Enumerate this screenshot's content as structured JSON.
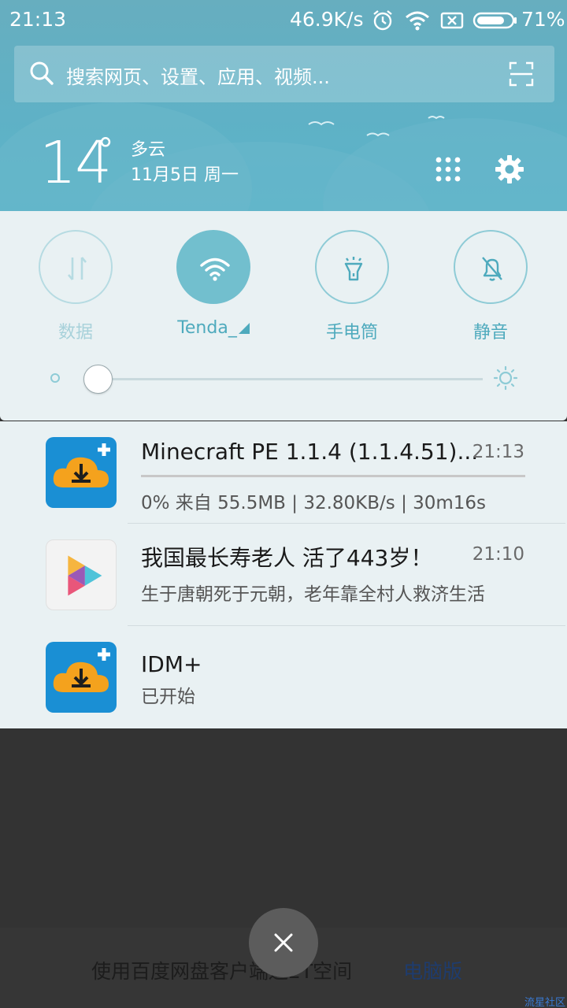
{
  "status_bar": {
    "time": "21:13",
    "net_speed": "46.9K/s",
    "battery_percent": "71%",
    "icons": [
      "alarm-icon",
      "wifi-icon",
      "sim-off-icon",
      "battery-icon"
    ]
  },
  "search": {
    "placeholder": "搜索网页、设置、应用、视频..."
  },
  "weather": {
    "temperature": "14",
    "degree": "°",
    "condition": "多云",
    "date": "11月5日 周一"
  },
  "toggles": [
    {
      "label": "数据",
      "icon": "data-transfer-icon",
      "state": "off"
    },
    {
      "label": "Tenda_",
      "icon": "wifi-icon",
      "state": "on"
    },
    {
      "label": "手电筒",
      "icon": "flashlight-icon",
      "state": "off"
    },
    {
      "label": "静音",
      "icon": "mute-bell-icon",
      "state": "off"
    }
  ],
  "brightness": {
    "level": 0.03
  },
  "notifications": [
    {
      "title": "Minecraft PE 1.1.4 (1.1.4.51)...",
      "time": "21:13",
      "subtitle": "0% 来自 55.5MB | 32.80KB/s | 30m16s",
      "progress": 0,
      "app_icon": "idm-download-icon"
    },
    {
      "title": "我国最长寿老人 活了443岁！",
      "time": "21:10",
      "subtitle": "生于唐朝死于元朝，老年靠全村人救济生活",
      "app_icon": "play-triangle-icon"
    },
    {
      "title": "IDM+",
      "subtitle": "已开始",
      "app_icon": "idm-download-icon"
    }
  ],
  "background_app": {
    "text": "使用百度网盘客户端送2T空间",
    "link": "电脑版"
  },
  "watermark": "流星社区",
  "colors": {
    "header": "#5fb1c6",
    "panel": "#e9f1f3",
    "accent": "#72bfce",
    "progress": "#4aa3c4"
  }
}
